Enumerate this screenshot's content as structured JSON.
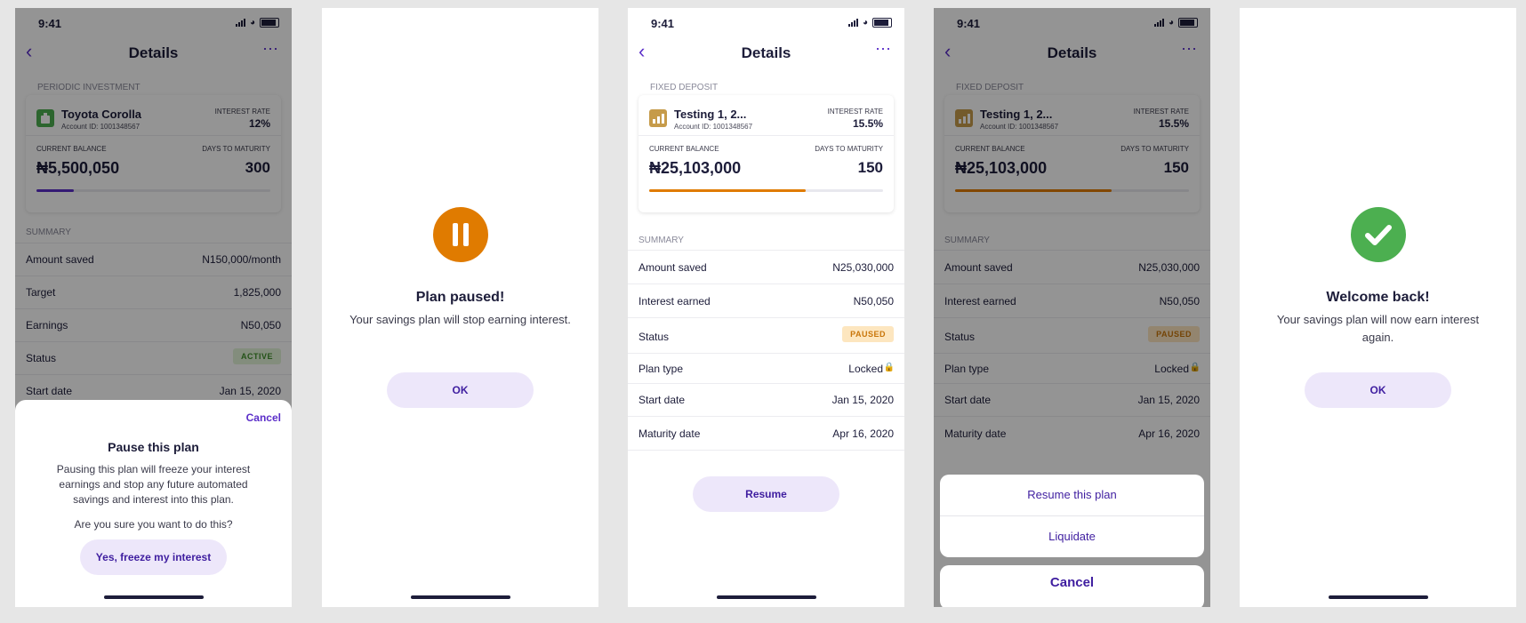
{
  "status": {
    "time": "9:41"
  },
  "details": {
    "title": "Details",
    "back_icon": "chevron-left-icon",
    "more_icon": "ellipsis-icon"
  },
  "screen1": {
    "section_label": "PERIODIC INVESTMENT",
    "plan_name": "Toyota Corolla",
    "account_id": "Account ID: 1001348567",
    "interest_label": "INTEREST RATE",
    "interest_value": "12%",
    "balance_label": "CURRENT BALANCE",
    "balance_value": "₦5,500,050",
    "days_label": "DAYS TO MATURITY",
    "days_value": "300",
    "progress": 0.16,
    "summary_label": "SUMMARY",
    "rows": [
      {
        "k": "Amount saved",
        "v": "N150,000/month"
      },
      {
        "k": "Target",
        "v": "1,825,000"
      },
      {
        "k": "Earnings",
        "v": "N50,050"
      },
      {
        "k": "Status",
        "v": "ACTIVE"
      },
      {
        "k": "Start date",
        "v": "Jan 15, 2020"
      }
    ],
    "sheet": {
      "cancel": "Cancel",
      "title": "Pause this plan",
      "body": "Pausing this plan will freeze your interest earnings and stop any future automated savings and interest into this plan.",
      "question": "Are you sure you want to do this?",
      "confirm": "Yes, freeze my interest"
    }
  },
  "screen2": {
    "title": "Plan paused!",
    "body": "Your savings plan will stop earning interest.",
    "ok": "OK",
    "icon": "pause-icon"
  },
  "fixed": {
    "section_label": "FIXED DEPOSIT",
    "plan_name": "Testing 1, 2...",
    "account_id": "Account ID: 1001348567",
    "interest_label": "INTEREST RATE",
    "interest_value": "15.5%",
    "balance_label": "CURRENT BALANCE",
    "balance_value": "₦25,103,000",
    "days_label": "DAYS TO MATURITY",
    "days_value": "150",
    "progress": 0.67,
    "summary_label": "SUMMARY",
    "rows": [
      {
        "k": "Amount saved",
        "v": "N25,030,000"
      },
      {
        "k": "Interest earned",
        "v": "N50,050"
      },
      {
        "k": "Status",
        "v": "PAUSED"
      },
      {
        "k": "Plan type",
        "v": "Locked"
      },
      {
        "k": "Start date",
        "v": "Jan 15, 2020"
      },
      {
        "k": "Maturity date",
        "v": "Apr 16, 2020"
      }
    ]
  },
  "screen3": {
    "resume": "Resume"
  },
  "screen4": {
    "resume_plan": "Resume this plan",
    "liquidate": "Liquidate",
    "cancel": "Cancel"
  },
  "screen5": {
    "title": "Welcome back!",
    "body": "Your savings plan will now earn interest again.",
    "ok": "OK",
    "icon": "checkmark-icon"
  },
  "colors": {
    "accent": "#5b2ec9",
    "paused": "#e07b00",
    "success": "#4caf50",
    "active_bg": "#e2f3d8",
    "paused_bg": "#fde6bf",
    "green_icon": "#4caf50",
    "gold_icon": "#c69b4a"
  }
}
